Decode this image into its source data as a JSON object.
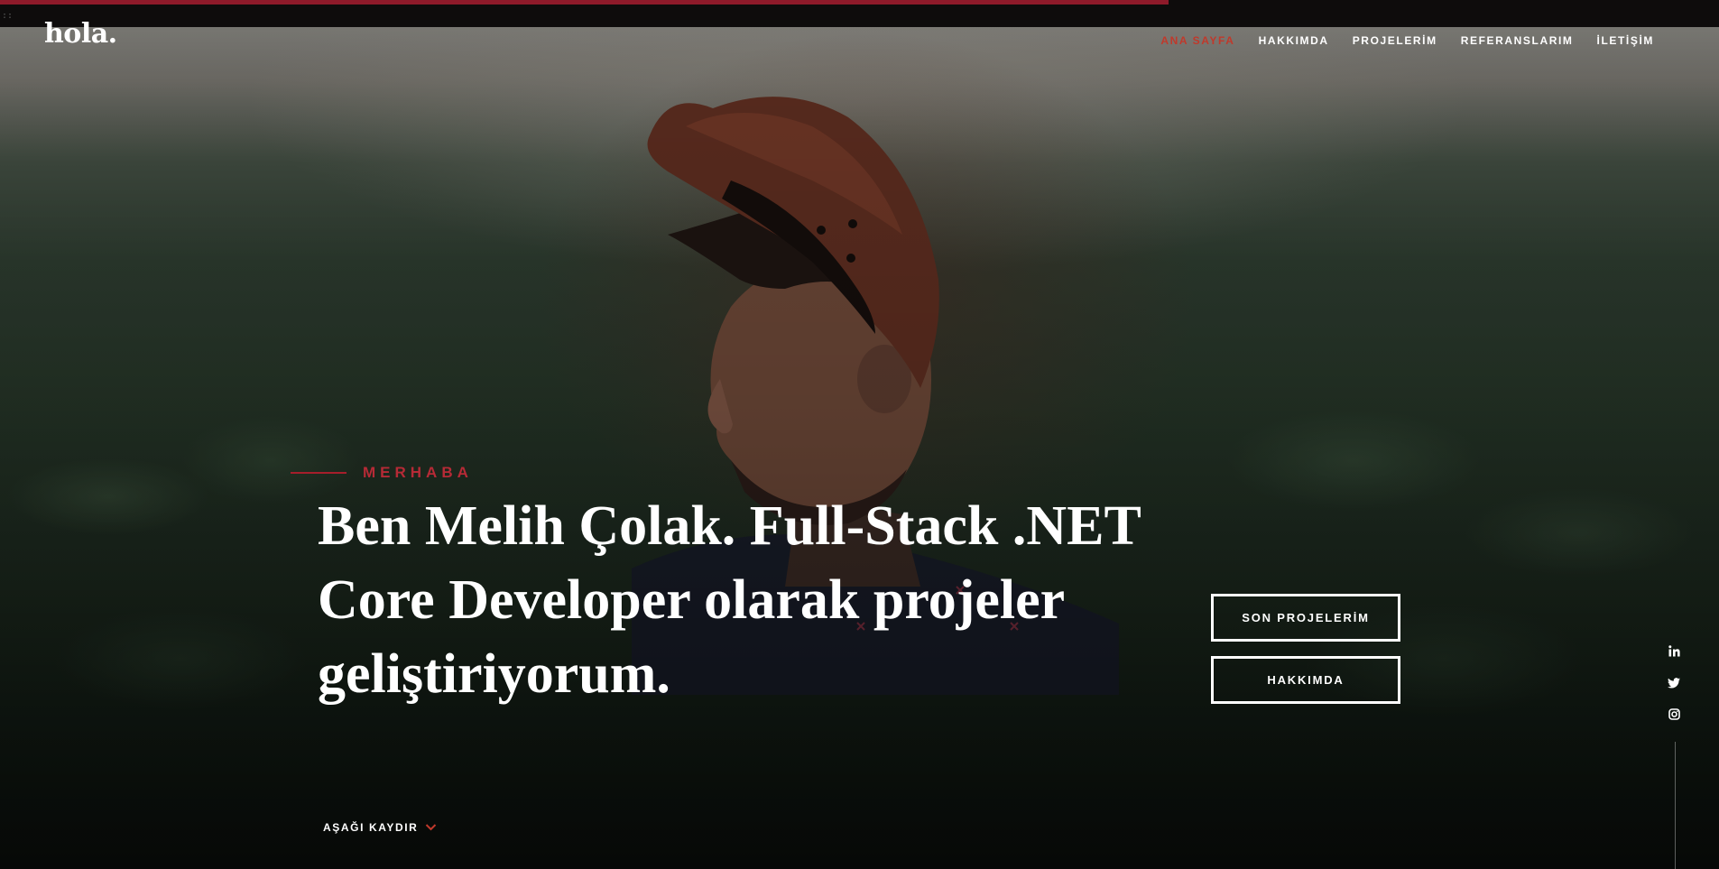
{
  "header": {
    "logo": "hola.",
    "nav": [
      {
        "label": "ANA SAYFA",
        "active": true
      },
      {
        "label": "HAKKIMDA",
        "active": false
      },
      {
        "label": "PROJELERİM",
        "active": false
      },
      {
        "label": "REFERANSLARIM",
        "active": false
      },
      {
        "label": "İLETİŞİM",
        "active": false
      }
    ]
  },
  "top_bar": {
    "glyph": "::",
    "progress_fraction": 0.68
  },
  "hero": {
    "intro_label": "MERHABA",
    "headline": "Ben Melih Çolak. Full-Stack .NET Core Developer olarak projeler geliştiriyorum.",
    "buttons": {
      "projects": "SON PROJELERİM",
      "about": "HAKKIMDA"
    },
    "scroll_label": "AŞAĞI KAYDIR"
  },
  "social": [
    {
      "icon": "linkedin-icon"
    },
    {
      "icon": "twitter-icon"
    },
    {
      "icon": "instagram-icon"
    }
  ],
  "colors": {
    "accent": "#b62a36",
    "progress": "#8e1a2a",
    "text": "#ffffff"
  }
}
